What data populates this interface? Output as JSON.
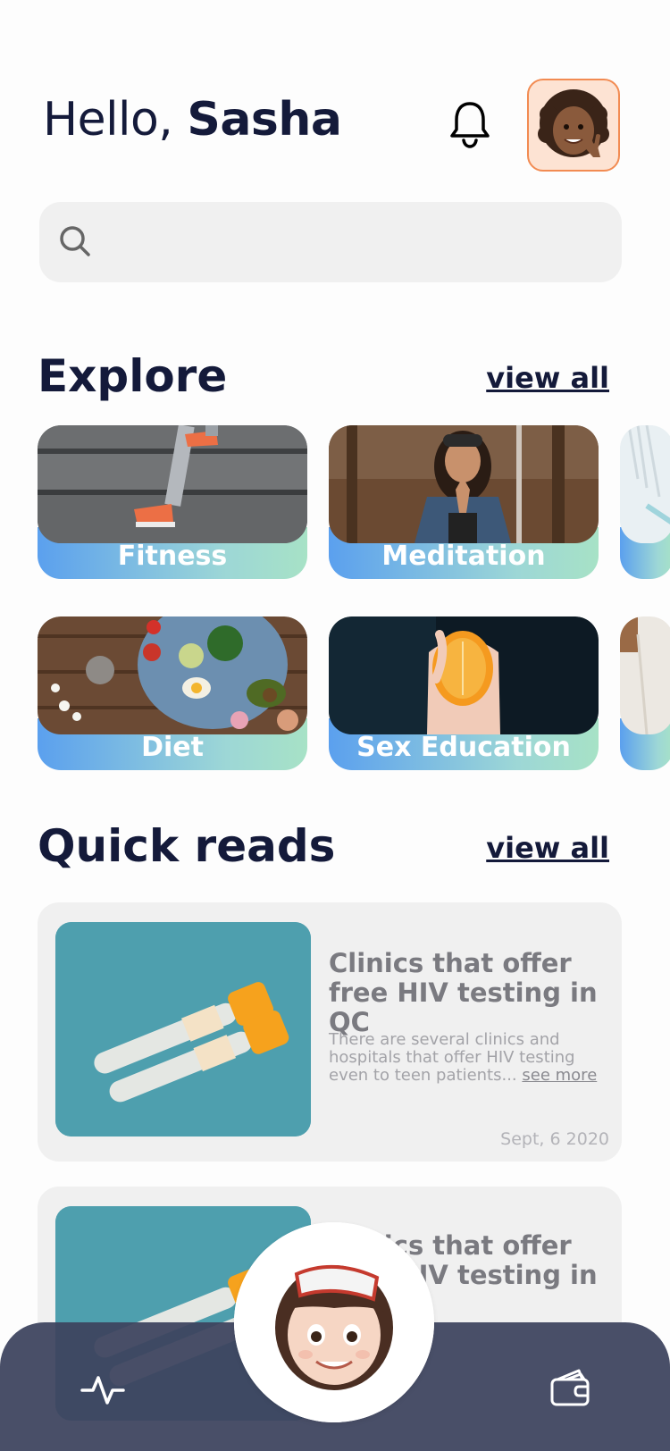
{
  "header": {
    "greeting_prefix": "Hello,",
    "user_name": "Sasha"
  },
  "search": {
    "placeholder": ""
  },
  "explore": {
    "title": "Explore",
    "view_all": "view all",
    "cards": [
      {
        "label": "Fitness"
      },
      {
        "label": "Meditation"
      },
      {
        "label": "Diet"
      },
      {
        "label": "Sex Education"
      }
    ]
  },
  "quick_reads": {
    "title": "Quick reads",
    "view_all": "view all",
    "items": [
      {
        "title": "Clinics that offer free HIV testing in QC",
        "description": "There are several clinics and hospitals that offer HIV testing even to teen patients...",
        "see_more": "see more",
        "date": "Sept, 6 2020"
      },
      {
        "title": "Clinics that offer free HIV testing in QC"
      }
    ]
  },
  "icons": [
    "bell-icon",
    "search-icon",
    "activity-icon",
    "wallet-icon"
  ],
  "colors": {
    "accent_orange": "#f28b52",
    "gradient_start": "#5ba0ee",
    "gradient_end": "#a7e2c6",
    "tabbar": "#3e445f",
    "text_dark": "#141a3a"
  }
}
